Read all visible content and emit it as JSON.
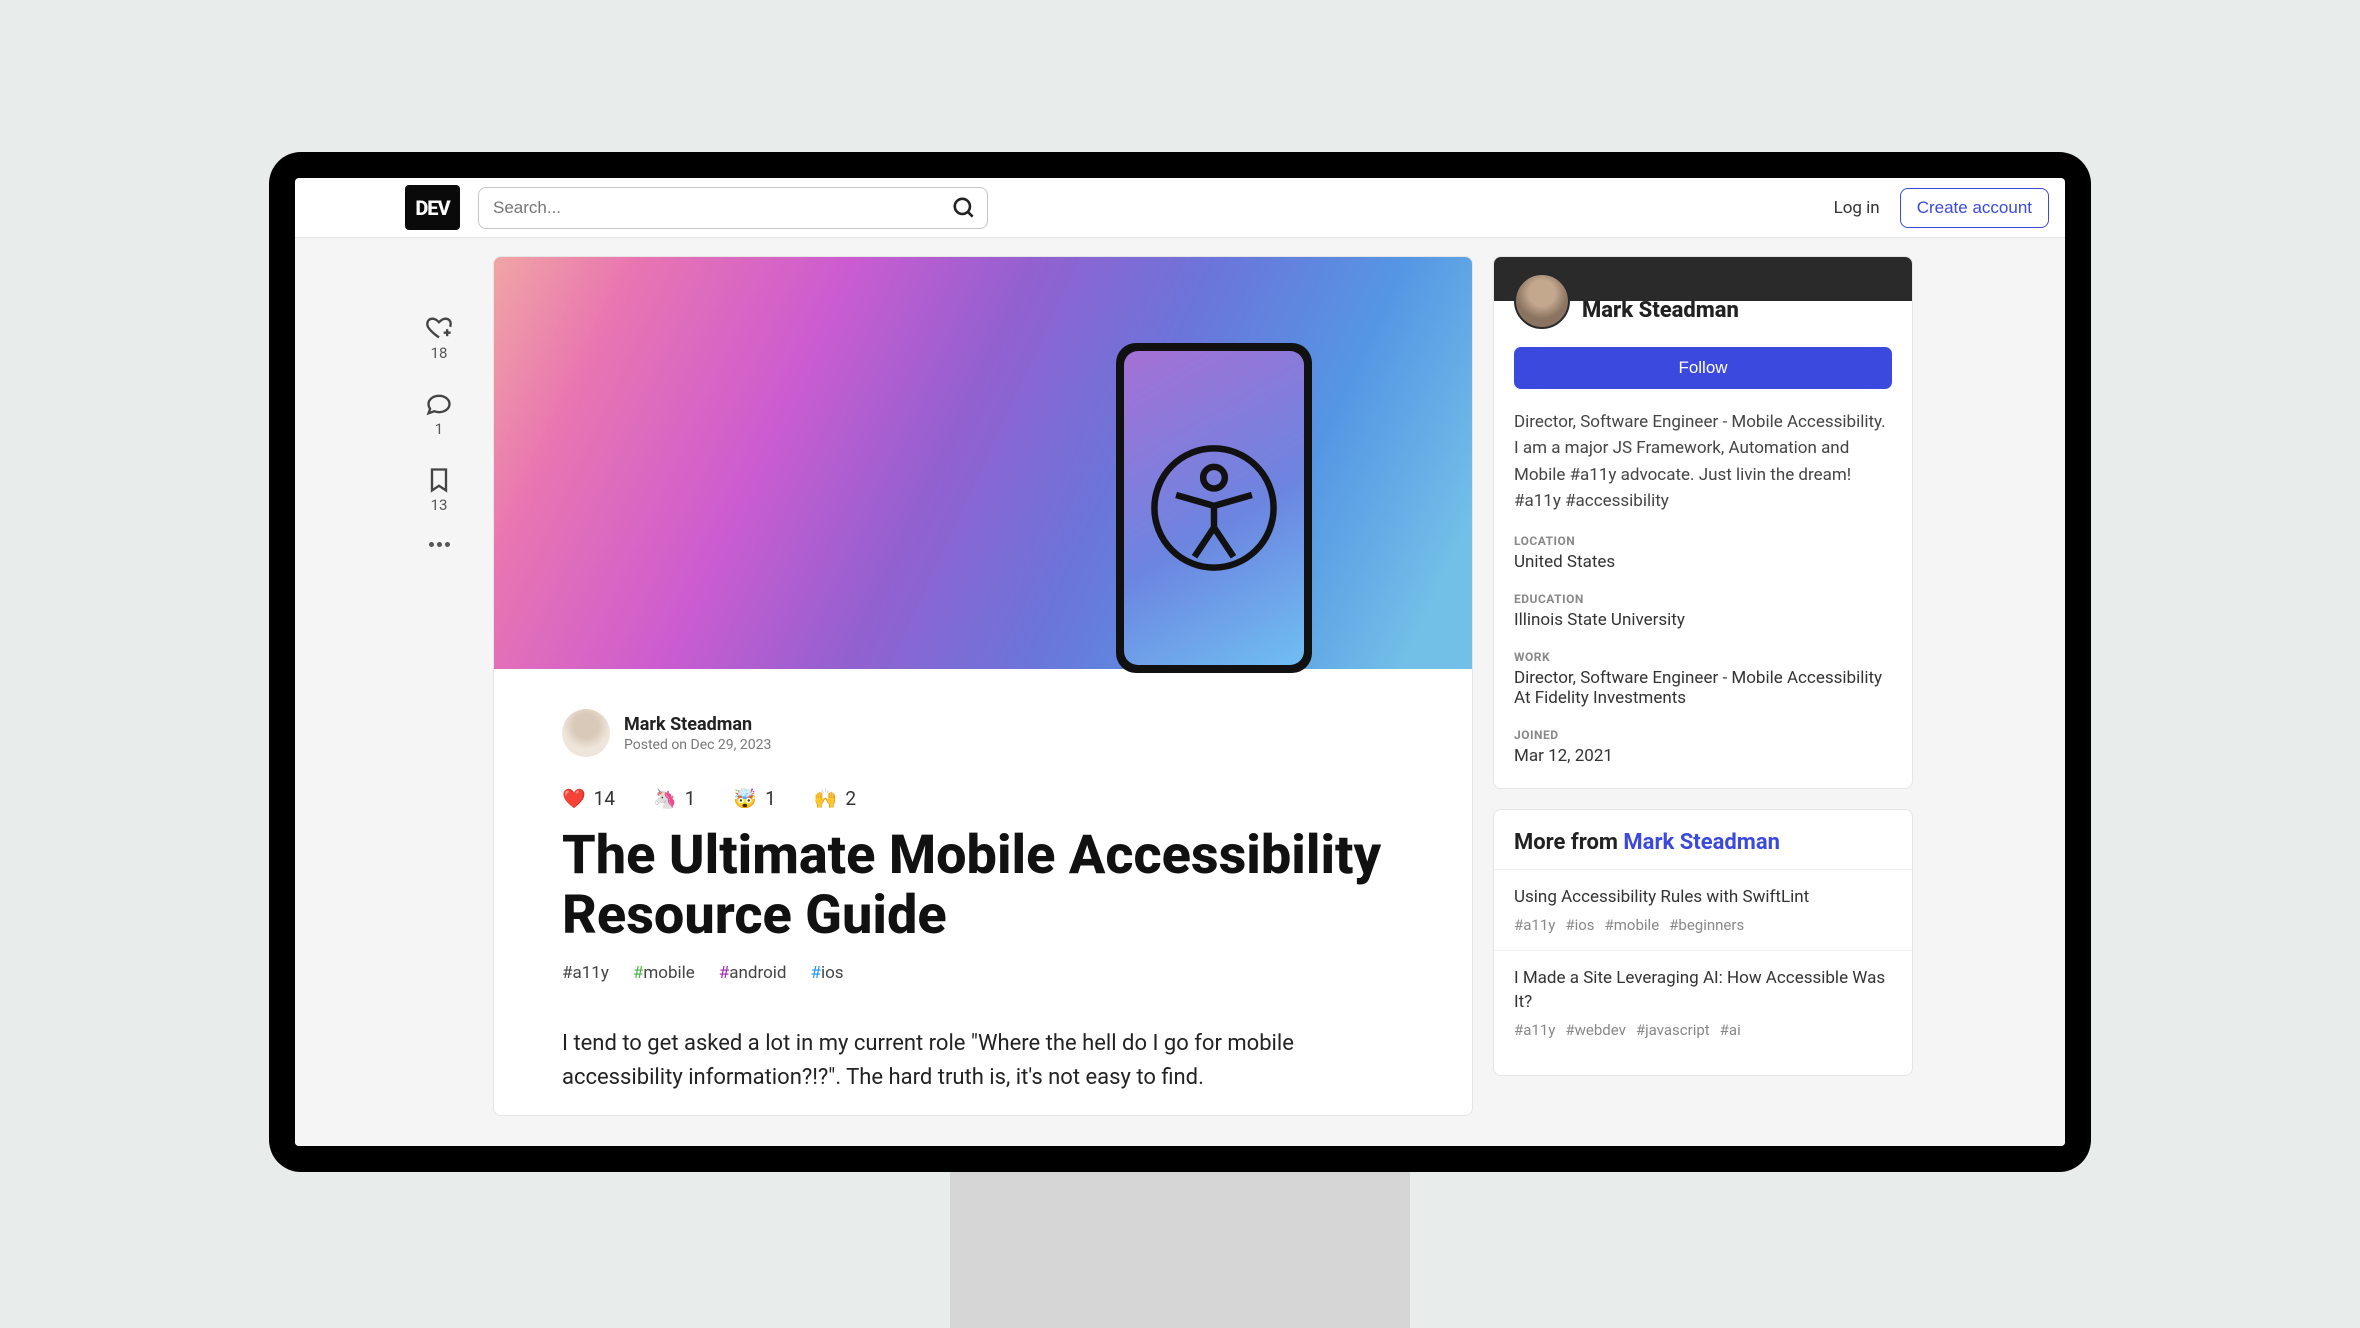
{
  "header": {
    "logo": "DEV",
    "search_placeholder": "Search...",
    "login": "Log in",
    "create_account": "Create account"
  },
  "rail": {
    "reactions": "18",
    "comments": "1",
    "saves": "13"
  },
  "article": {
    "author": "Mark Steadman",
    "posted": "Posted on Dec 29, 2023",
    "reactions": [
      {
        "emoji": "❤️",
        "count": "14"
      },
      {
        "emoji": "🦄",
        "count": "1"
      },
      {
        "emoji": "🤯",
        "count": "1"
      },
      {
        "emoji": "🙌",
        "count": "2"
      }
    ],
    "title": "The Ultimate Mobile Accessibility Resource Guide",
    "tags": [
      {
        "hash_class": "hash-a11y",
        "text": "a11y"
      },
      {
        "hash_class": "hash-mobile",
        "text": "mobile"
      },
      {
        "hash_class": "hash-android",
        "text": "android"
      },
      {
        "hash_class": "hash-ios",
        "text": "ios"
      }
    ],
    "body_p1": "I tend to get asked a lot in my current role \"Where the hell do I go for mobile accessibility information?!?\". The hard truth is, it's not easy to find."
  },
  "profile": {
    "name": "Mark Steadman",
    "follow": "Follow",
    "bio": "Director, Software Engineer - Mobile Accessibility. I am a major JS Framework, Automation and Mobile #a11y advocate. Just livin the dream! #a11y #accessibility",
    "location_label": "LOCATION",
    "location": "United States",
    "education_label": "EDUCATION",
    "education": "Illinois State University",
    "work_label": "WORK",
    "work": "Director, Software Engineer - Mobile Accessibility At Fidelity Investments",
    "joined_label": "JOINED",
    "joined": "Mar 12, 2021"
  },
  "more": {
    "prefix": "More from ",
    "author": "Mark Steadman",
    "items": [
      {
        "title": "Using Accessibility Rules with SwiftLint",
        "tags": [
          "#a11y",
          "#ios",
          "#mobile",
          "#beginners"
        ]
      },
      {
        "title": "I Made a Site Leveraging AI: How Accessible Was It?",
        "tags": [
          "#a11y",
          "#webdev",
          "#javascript",
          "#ai"
        ]
      }
    ]
  }
}
